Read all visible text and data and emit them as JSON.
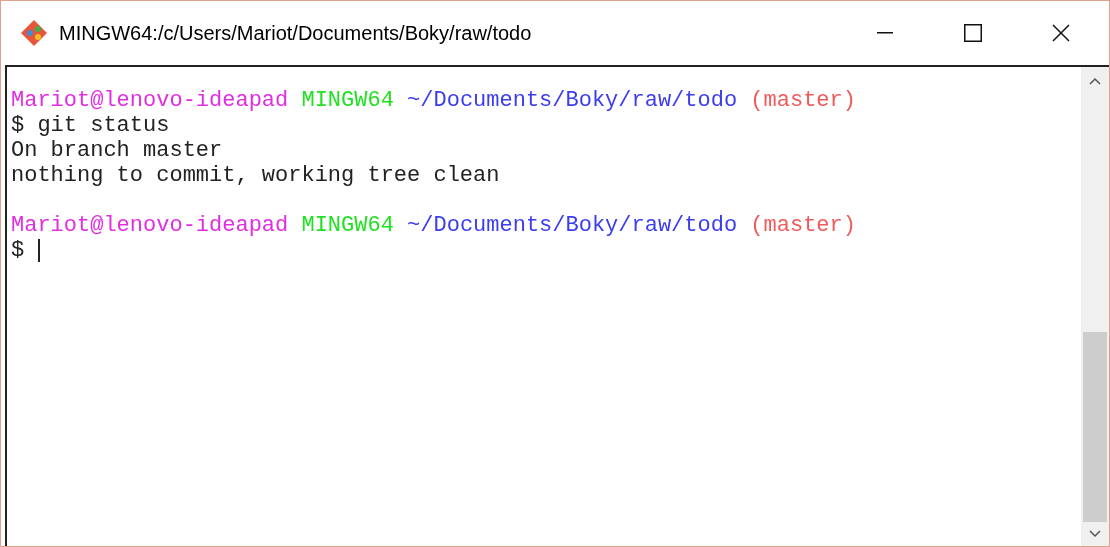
{
  "window": {
    "title": "MINGW64:/c/Users/Mariot/Documents/Boky/raw/todo"
  },
  "terminal": {
    "lines": [
      {
        "kind": "prompt",
        "segments": [
          {
            "kind": "user",
            "text": "Mariot@lenovo-ideapad"
          },
          {
            "kind": "host",
            "text": "MINGW64"
          },
          {
            "kind": "path",
            "text": "~/Documents/Boky/raw/todo"
          },
          {
            "kind": "branch",
            "text": "(master)"
          }
        ]
      },
      {
        "kind": "command",
        "text": "$ git status"
      },
      {
        "kind": "output",
        "text": "On branch master"
      },
      {
        "kind": "output",
        "text": "nothing to commit, working tree clean"
      },
      {
        "kind": "blank"
      },
      {
        "kind": "prompt",
        "segments": [
          {
            "kind": "user",
            "text": "Mariot@lenovo-ideapad"
          },
          {
            "kind": "host",
            "text": "MINGW64"
          },
          {
            "kind": "path",
            "text": "~/Documents/Boky/raw/todo"
          },
          {
            "kind": "branch",
            "text": "(master)"
          }
        ]
      },
      {
        "kind": "input",
        "text": "$",
        "cursor": true
      }
    ]
  }
}
